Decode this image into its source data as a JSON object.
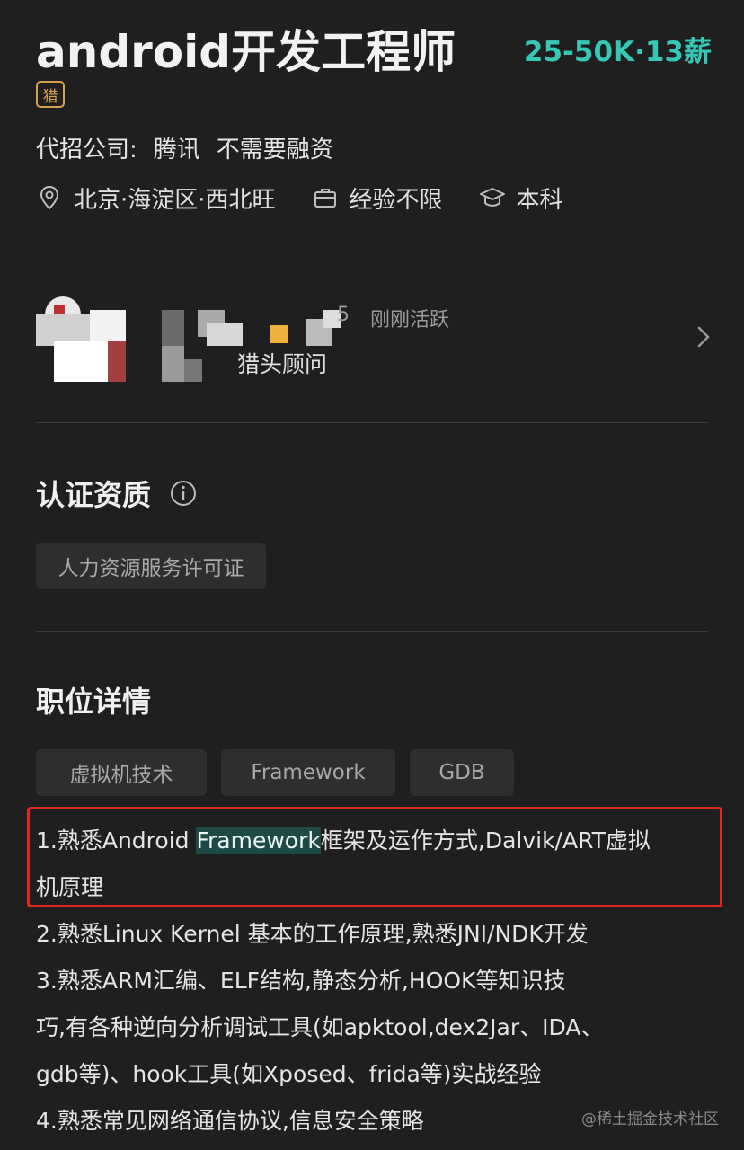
{
  "header": {
    "job_title": "android开发工程师",
    "salary": "25-50K·13薪",
    "hunt_badge": "猎"
  },
  "company": {
    "label": "代招公司:",
    "name": "腾讯",
    "funding": "不需要融资"
  },
  "meta": {
    "location": "北京·海淀区·西北旺",
    "experience": "经验不限",
    "education": "本科"
  },
  "recruiter": {
    "active_status": "刚刚活跃",
    "role": "猎头顾问",
    "name_fragment": "5"
  },
  "certification": {
    "title": "认证资质",
    "tag": "人力资源服务许可证"
  },
  "job_detail": {
    "title": "职位详情",
    "tags": [
      "虚拟机技术",
      "Framework",
      "GDB"
    ],
    "line1_pre": "1.熟悉Android ",
    "line1_hl": "Framework",
    "line1_post": "框架及运作方式,Dalvik/ART虚拟",
    "line2": "机原理",
    "line3": "2.熟悉Linux Kernel 基本的工作原理,熟悉JNI/NDK开发",
    "line4": "3.熟悉ARM汇编、ELF结构,静态分析,HOOK等知识技",
    "line5": "巧,有各种逆向分析调试工具(如apktool,dex2Jar、IDA、",
    "line6": "gdb等)、hook工具(如Xposed、frida等)实战经验",
    "line7": "4.熟悉常见网络通信协议,信息安全策略"
  },
  "watermark": "@稀土掘金技术社区",
  "colors": {
    "background": "#1f1f1f",
    "salary": "#36c7b6",
    "badge": "#d9a04a",
    "highlight": "#1e4a46",
    "annotation_box": "#e0281f"
  }
}
